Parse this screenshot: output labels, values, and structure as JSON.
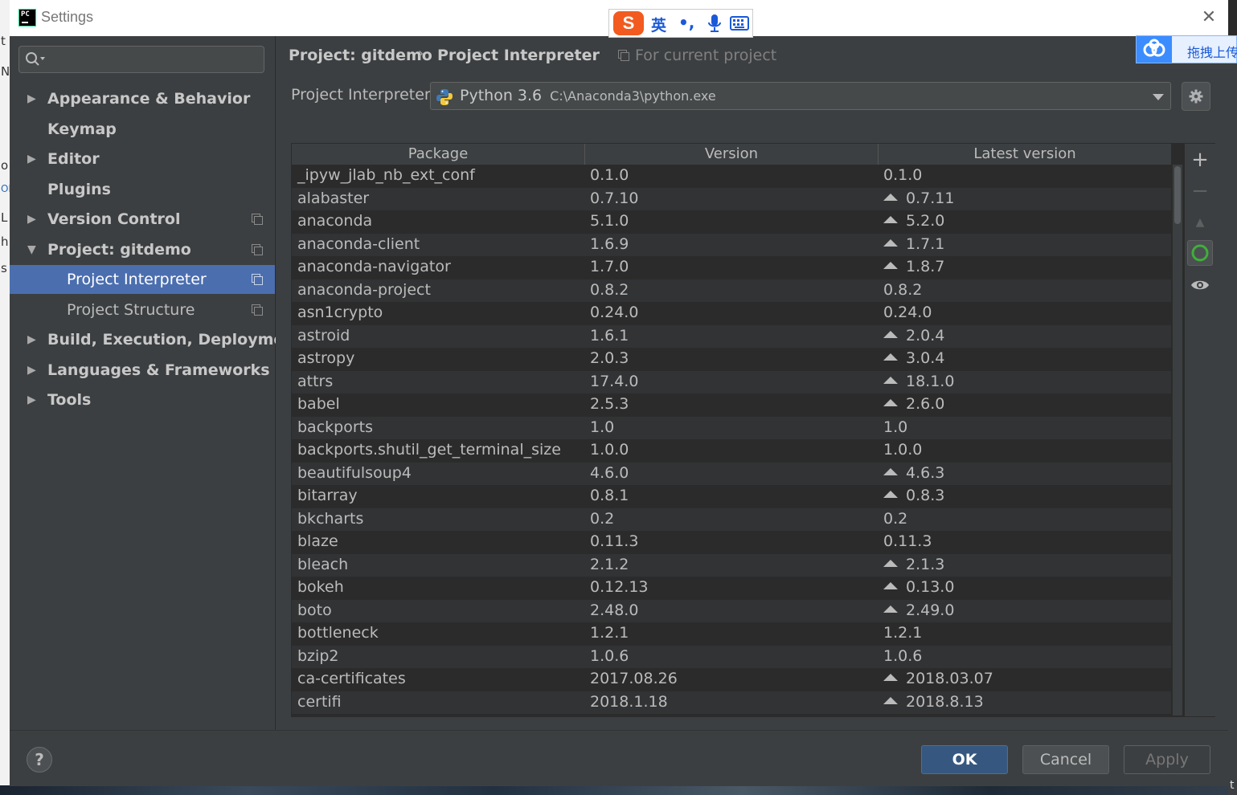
{
  "window": {
    "title": "Settings",
    "close_glyph": "✕"
  },
  "ime": {
    "logo": "S",
    "mode": "英",
    "punct": "•,",
    "icons": [
      "mic-icon",
      "keyboard-icon"
    ]
  },
  "baidu": {
    "text": "拖拽上传"
  },
  "background": {
    "left_chars": [
      "t",
      "N",
      "o",
      "ON",
      "L",
      "h",
      "s"
    ],
    "right_char": "t"
  },
  "sidebar": {
    "search_placeholder": "",
    "items": [
      {
        "label": "Appearance & Behavior",
        "expander": "▶"
      },
      {
        "label": "Keymap"
      },
      {
        "label": "Editor",
        "expander": "▶"
      },
      {
        "label": "Plugins"
      },
      {
        "label": "Version Control",
        "expander": "▶"
      },
      {
        "label": "Project: gitdemo",
        "expander": "▼"
      },
      {
        "label": "Project Interpreter",
        "selected": true
      },
      {
        "label": "Project Structure"
      },
      {
        "label": "Build, Execution, Deployment",
        "expander": "▶"
      },
      {
        "label": "Languages & Frameworks",
        "expander": "▶"
      },
      {
        "label": "Tools",
        "expander": "▶"
      }
    ]
  },
  "main": {
    "breadcrumb": {
      "project": "Project: gitdemo",
      "separator": "›",
      "page": "Project Interpreter"
    },
    "for_current_project": "For current project",
    "interpreter_label": "Project Interpreter:",
    "interpreter_name": "Python 3.6",
    "interpreter_path": "C:\\Anaconda3\\python.exe"
  },
  "table": {
    "columns": [
      "Package",
      "Version",
      "Latest version"
    ],
    "rows": [
      {
        "package": "_ipyw_jlab_nb_ext_conf",
        "version": "0.1.0",
        "latest": "0.1.0",
        "upgrade": false
      },
      {
        "package": "alabaster",
        "version": "0.7.10",
        "latest": "0.7.11",
        "upgrade": true
      },
      {
        "package": "anaconda",
        "version": "5.1.0",
        "latest": "5.2.0",
        "upgrade": true
      },
      {
        "package": "anaconda-client",
        "version": "1.6.9",
        "latest": "1.7.1",
        "upgrade": true
      },
      {
        "package": "anaconda-navigator",
        "version": "1.7.0",
        "latest": "1.8.7",
        "upgrade": true
      },
      {
        "package": "anaconda-project",
        "version": "0.8.2",
        "latest": "0.8.2",
        "upgrade": false
      },
      {
        "package": "asn1crypto",
        "version": "0.24.0",
        "latest": "0.24.0",
        "upgrade": false
      },
      {
        "package": "astroid",
        "version": "1.6.1",
        "latest": "2.0.4",
        "upgrade": true
      },
      {
        "package": "astropy",
        "version": "2.0.3",
        "latest": "3.0.4",
        "upgrade": true
      },
      {
        "package": "attrs",
        "version": "17.4.0",
        "latest": "18.1.0",
        "upgrade": true
      },
      {
        "package": "babel",
        "version": "2.5.3",
        "latest": "2.6.0",
        "upgrade": true
      },
      {
        "package": "backports",
        "version": "1.0",
        "latest": "1.0",
        "upgrade": false
      },
      {
        "package": "backports.shutil_get_terminal_size",
        "version": "1.0.0",
        "latest": "1.0.0",
        "upgrade": false
      },
      {
        "package": "beautifulsoup4",
        "version": "4.6.0",
        "latest": "4.6.3",
        "upgrade": true
      },
      {
        "package": "bitarray",
        "version": "0.8.1",
        "latest": "0.8.3",
        "upgrade": true
      },
      {
        "package": "bkcharts",
        "version": "0.2",
        "latest": "0.2",
        "upgrade": false
      },
      {
        "package": "blaze",
        "version": "0.11.3",
        "latest": "0.11.3",
        "upgrade": false
      },
      {
        "package": "bleach",
        "version": "2.1.2",
        "latest": "2.1.3",
        "upgrade": true
      },
      {
        "package": "bokeh",
        "version": "0.12.13",
        "latest": "0.13.0",
        "upgrade": true
      },
      {
        "package": "boto",
        "version": "2.48.0",
        "latest": "2.49.0",
        "upgrade": true
      },
      {
        "package": "bottleneck",
        "version": "1.2.1",
        "latest": "1.2.1",
        "upgrade": false
      },
      {
        "package": "bzip2",
        "version": "1.0.6",
        "latest": "1.0.6",
        "upgrade": false
      },
      {
        "package": "ca-certificates",
        "version": "2017.08.26",
        "latest": "2018.03.07",
        "upgrade": true
      },
      {
        "package": "certifi",
        "version": "2018.1.18",
        "latest": "2018.8.13",
        "upgrade": true
      }
    ]
  },
  "toolbar": {
    "add": "+",
    "remove": "−",
    "upgrade_glyph": "▲"
  },
  "footer": {
    "help": "?",
    "ok": "OK",
    "cancel": "Cancel",
    "apply": "Apply"
  },
  "colors": {
    "selection": "#4b6eaf",
    "ok_button": "#365880",
    "background": "#3c3f41",
    "table_bg": "#2b2b2b"
  }
}
